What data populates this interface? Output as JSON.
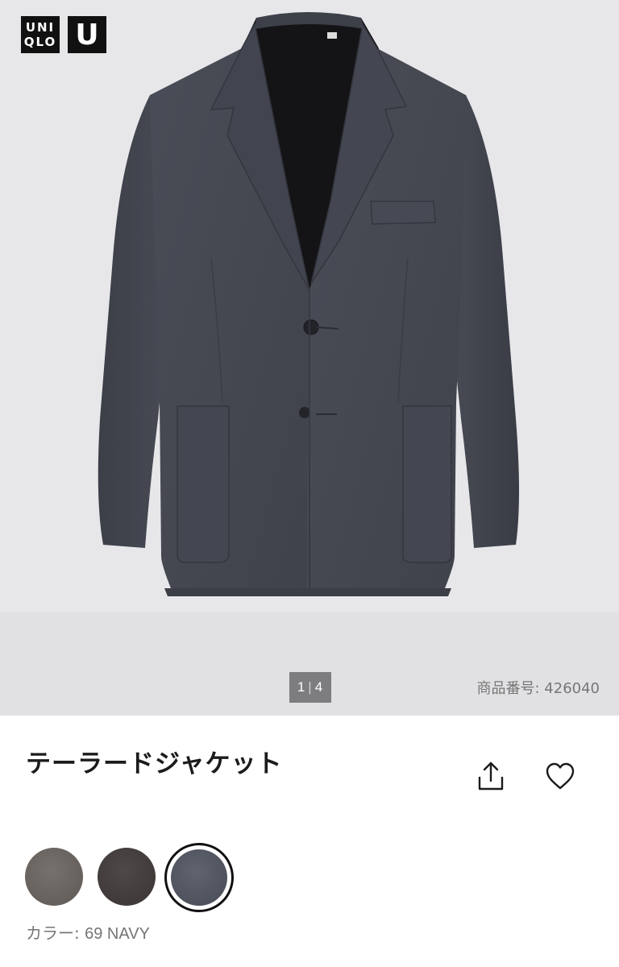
{
  "brand": {
    "logo_text_line1": "UNI",
    "logo_text_line2": "QLO",
    "logo_u": "U"
  },
  "gallery": {
    "current": "1",
    "total": "4",
    "separator": "|",
    "image_icon": "jacket-image"
  },
  "product": {
    "sku_label": "商品番号: 426040",
    "title": "テーラードジャケット",
    "share_icon": "share-icon",
    "favorite_icon": "heart-icon"
  },
  "colors": {
    "label_prefix": "カラー: ",
    "selected_value": "69 NAVY",
    "swatches": [
      {
        "color": "#6b6560"
      },
      {
        "color": "#443f3e"
      },
      {
        "color": "#555a64",
        "selected": true
      }
    ]
  }
}
